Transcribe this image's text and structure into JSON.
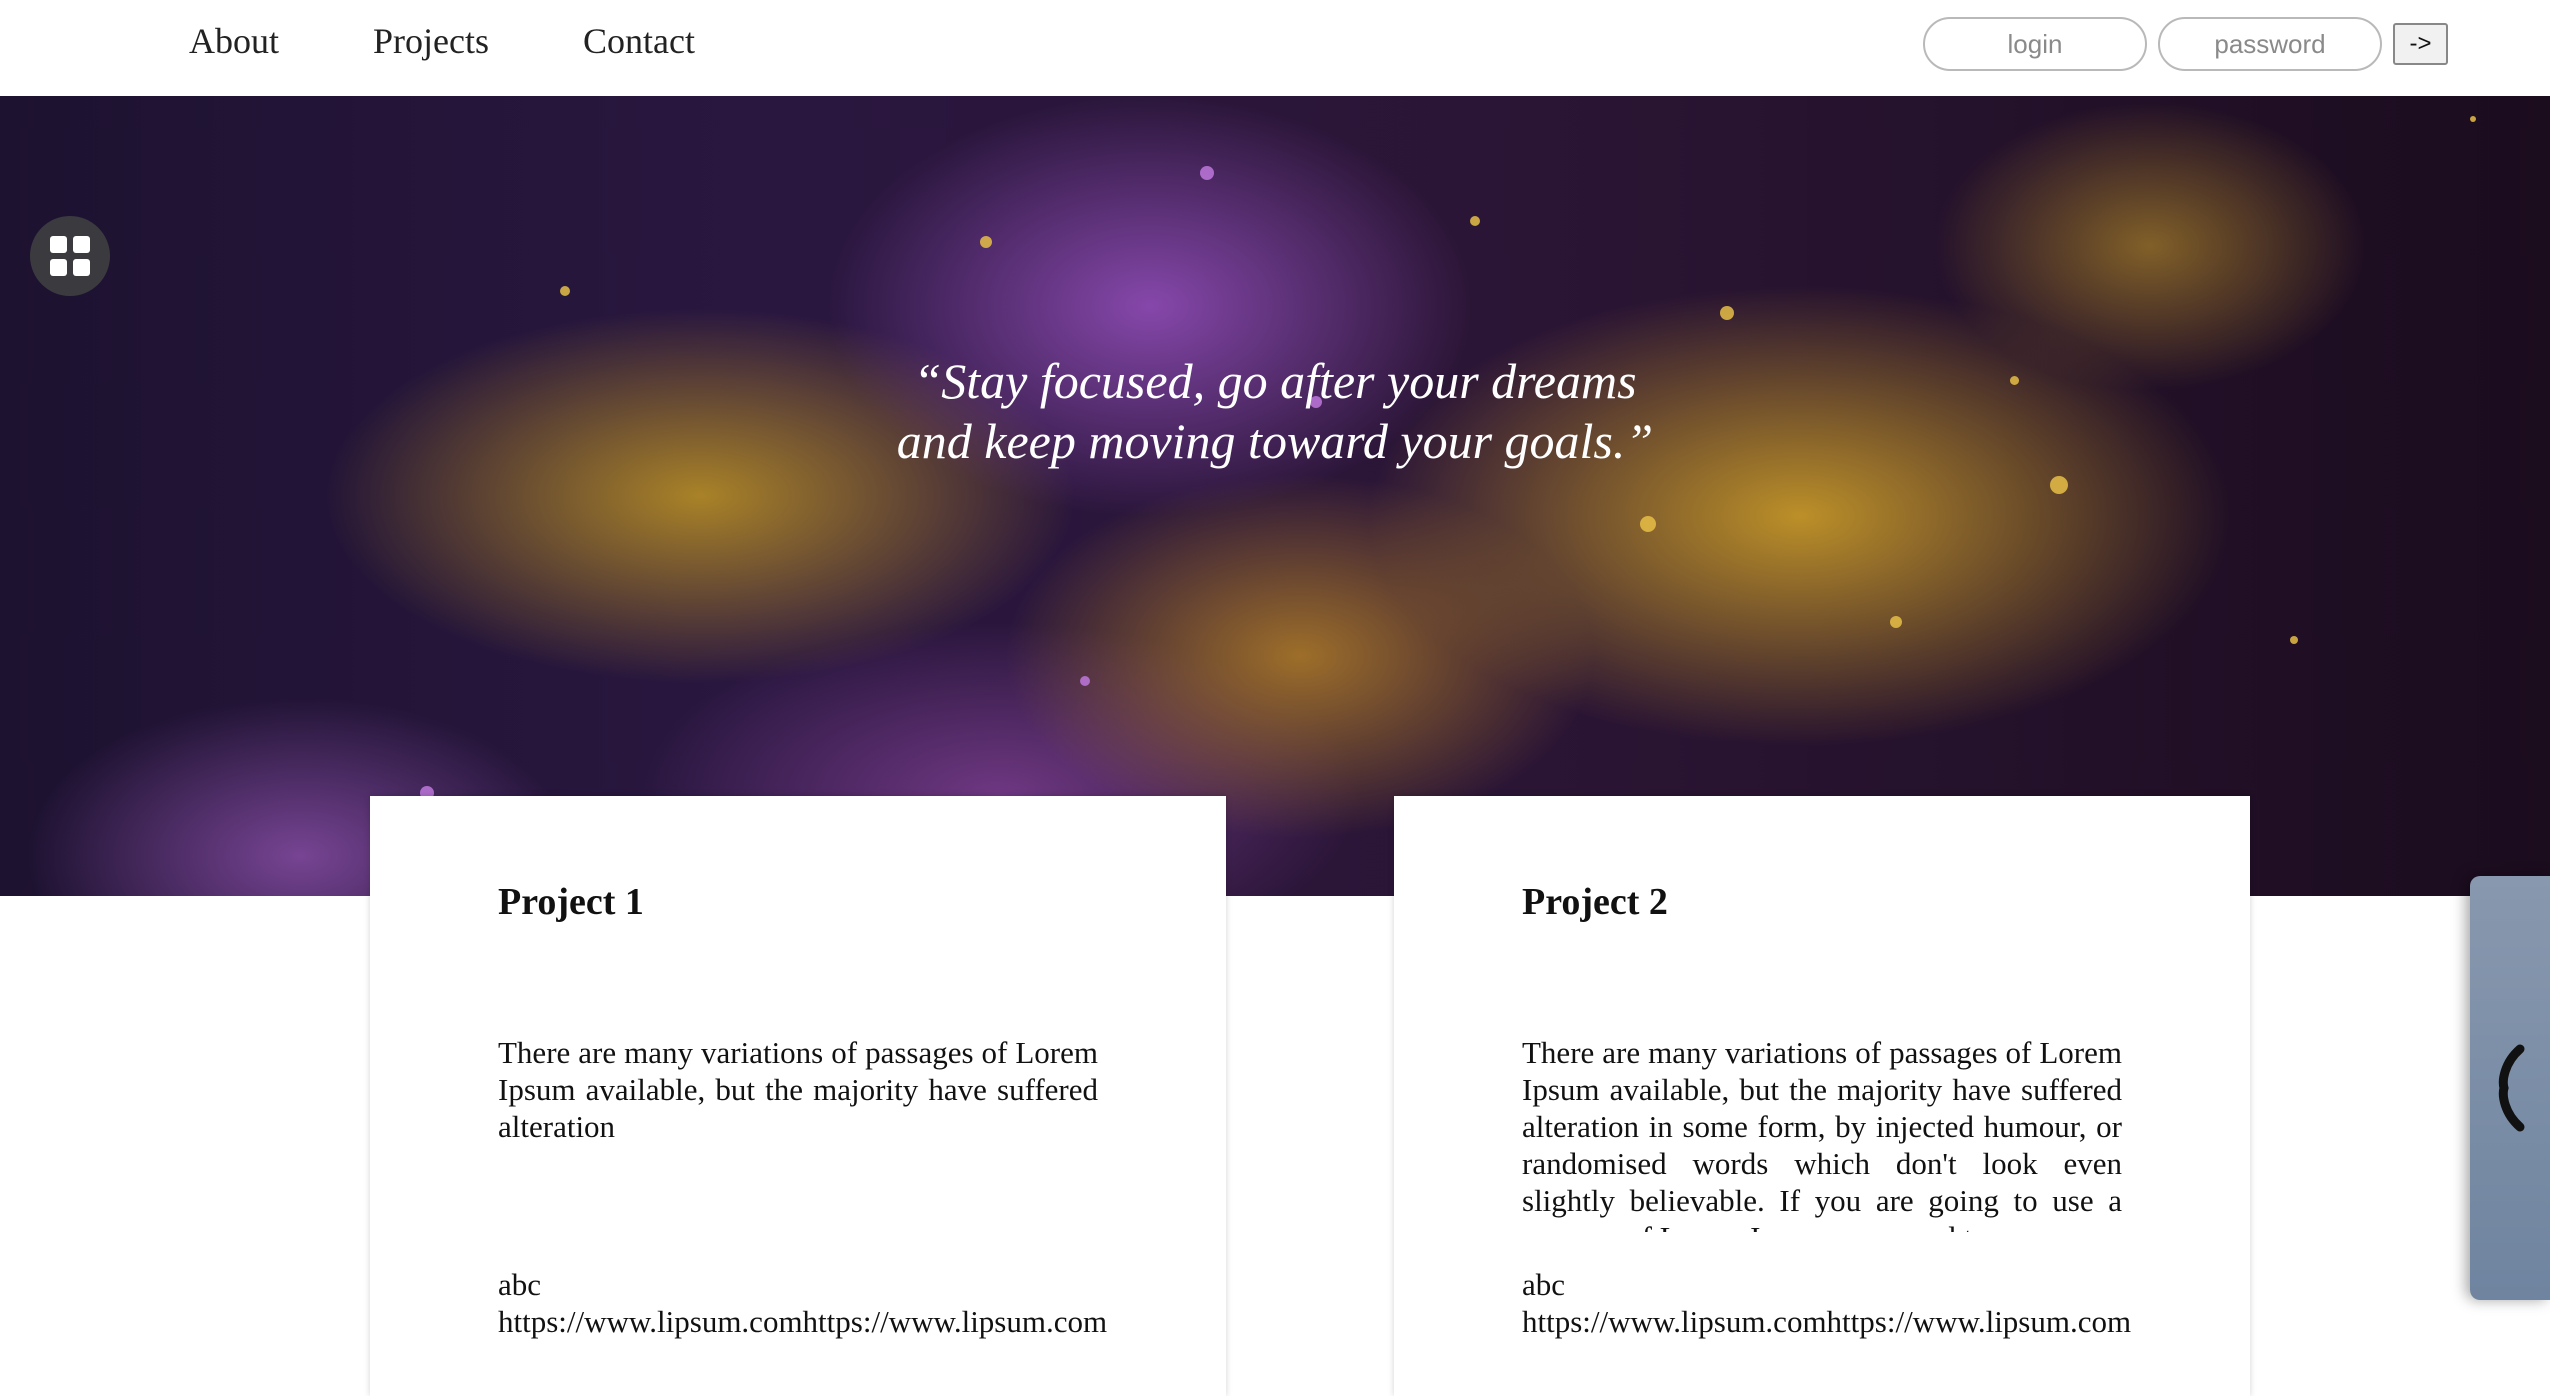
{
  "nav": {
    "items": [
      {
        "label": "About"
      },
      {
        "label": "Projects"
      },
      {
        "label": "Contact"
      }
    ]
  },
  "login": {
    "login_placeholder": "login",
    "password_placeholder": "password",
    "submit_label": "->"
  },
  "hero": {
    "quote_line1": "“Stay focused, go after your dreams",
    "quote_line2": "and keep moving toward your goals.”"
  },
  "projects": [
    {
      "title": "Project 1",
      "description": "There are many variations of passages of Lorem Ipsum available, but the majority have suffered alteration",
      "name": "abc",
      "link": "https://www.lipsum.comhttps://www.lipsum.com"
    },
    {
      "title": "Project 2",
      "description": "There are many variations of passages of Lorem Ipsum available, but the majority have suffered alteration in some form, by injected humour, or randomised words which don't look even slightly believable. If you are going to use a passage of Lorem Ipsum, you need to",
      "name": "abc",
      "link": "https://www.lipsum.comhttps://www.lipsum.com"
    }
  ],
  "icons": {
    "apps": "grid-icon",
    "side_panel": "chevron-left-icon"
  }
}
